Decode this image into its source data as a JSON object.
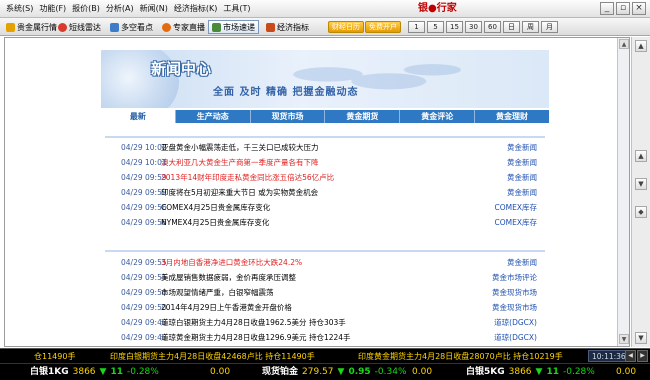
{
  "menu": [
    "系统(S)",
    "功能(F)",
    "报价(B)",
    "分析(A)",
    "新闻(N)",
    "经济指标(K)",
    "工具(T)"
  ],
  "app_logo": "银●行家",
  "window": {
    "minimize": "_",
    "restore": "▫",
    "close": "×"
  },
  "toolbar": {
    "items": [
      {
        "label": "贵金属行情",
        "icon": "gold-bars-icon",
        "color": "#e5a100"
      },
      {
        "label": "短线雷达",
        "icon": "radar-icon",
        "color": "#d93a2b"
      },
      {
        "label": "多空看点",
        "icon": "bull-bear-icon",
        "color": "#3d7cc9"
      },
      {
        "label": "专家直播",
        "icon": "expert-icon",
        "color": "#e46a10"
      },
      {
        "label": "市场速递",
        "icon": "news-icon",
        "color": "#4b8a3a"
      },
      {
        "label": "经济指标",
        "icon": "indicator-icon",
        "color": "#c74b1b"
      }
    ],
    "active_index": 4,
    "finance_calendar": "财经日历",
    "open_account": "免费开户",
    "period_buttons": [
      "1",
      "5",
      "15",
      "30",
      "60",
      "日",
      "周",
      "月"
    ]
  },
  "banner": {
    "title": "新闻中心",
    "slogan": "全面  及时  精确    把握金融动态"
  },
  "tabs": [
    "最新",
    "生产动态",
    "现货市场",
    "黄金期货",
    "黄金评论",
    "黄金理财"
  ],
  "active_tab": 0,
  "news_group_1": [
    {
      "time": "04/29 10:02",
      "headline": "亚盘黄金小幅震荡走低，千三关口已成较大压力",
      "category": "黄金新闻",
      "highlight": false
    },
    {
      "time": "04/29 10:01",
      "headline": "澳大利亚几大黄金生产商第一季度产量各有下降",
      "category": "黄金新闻",
      "highlight": true
    },
    {
      "time": "04/29 09:59",
      "headline": "2013年14财年印度走私黄金同比涨五倍达56亿卢比",
      "category": "黄金新闻",
      "highlight": true
    },
    {
      "time": "04/29 09:59",
      "headline": "印度将在5月初迎来重大节日 或为实物黄金机会",
      "category": "黄金新闻",
      "highlight": false
    },
    {
      "time": "04/29 09:56",
      "headline": "COMEX4月25日贵金属库存变化",
      "category": "COMEX库存",
      "highlight": false
    },
    {
      "time": "04/29 09:56",
      "headline": "NYMEX4月25日贵金属库存变化",
      "category": "COMEX库存",
      "highlight": false
    }
  ],
  "news_group_2": [
    {
      "time": "04/29 09:55",
      "headline": "3月内地自香港净进口黄金环比大跌24.2%",
      "category": "黄金新闻",
      "highlight": true
    },
    {
      "time": "04/29 09:55",
      "headline": "美成屋销售数据疲弱，金价再度承压调整",
      "category": "黄金市场评论",
      "highlight": false
    },
    {
      "time": "04/29 09:50",
      "headline": "市场观望情绪严重，白银窄幅震荡",
      "category": "黄金现货市场",
      "highlight": false
    },
    {
      "time": "04/29 09:50",
      "headline": "2014年4月29日上午香港黄金开盘价格",
      "category": "黄金现货市场",
      "highlight": false
    },
    {
      "time": "04/29 09:46",
      "headline": "道琼白银期货主力4月28日收盘1962.5美分 持仓303手",
      "category": "道琼(DGCX)",
      "highlight": false
    },
    {
      "time": "04/29 09:46",
      "headline": "道琼黄金期货主力4月28日收盘1296.9美元 持仓1224手",
      "category": "道琼(DGCX)",
      "highlight": false
    }
  ],
  "ticker_text": [
    "仓11490手",
    "印度白银期货主力4月28日收盘42468卢比 持仓11490手",
    "印度黄金期货主力4月28日收盘28070卢比 持仓10219手"
  ],
  "clock": "10:11:36",
  "quotes": [
    {
      "name": "白银1KG",
      "price": "3866",
      "arrow": "▼",
      "change": "11",
      "pct": "-0.28%",
      "dir": "down"
    },
    {
      "name": "",
      "price": "0.00",
      "arrow": "",
      "change": "",
      "pct": "",
      "dir": "flat"
    },
    {
      "name": "现货铂金",
      "price": "279.57",
      "arrow": "▼",
      "change": "0.95",
      "pct": "-0.34%",
      "dir": "down"
    },
    {
      "name": "",
      "price": "0.00",
      "arrow": "",
      "change": "",
      "pct": "",
      "dir": "flat"
    },
    {
      "name": "白银5KG",
      "price": "3866",
      "arrow": "▼",
      "change": "11",
      "pct": "-0.28%",
      "dir": "down"
    },
    {
      "name": "",
      "price": "0.00",
      "arrow": "",
      "change": "",
      "pct": "",
      "dir": "flat"
    }
  ]
}
